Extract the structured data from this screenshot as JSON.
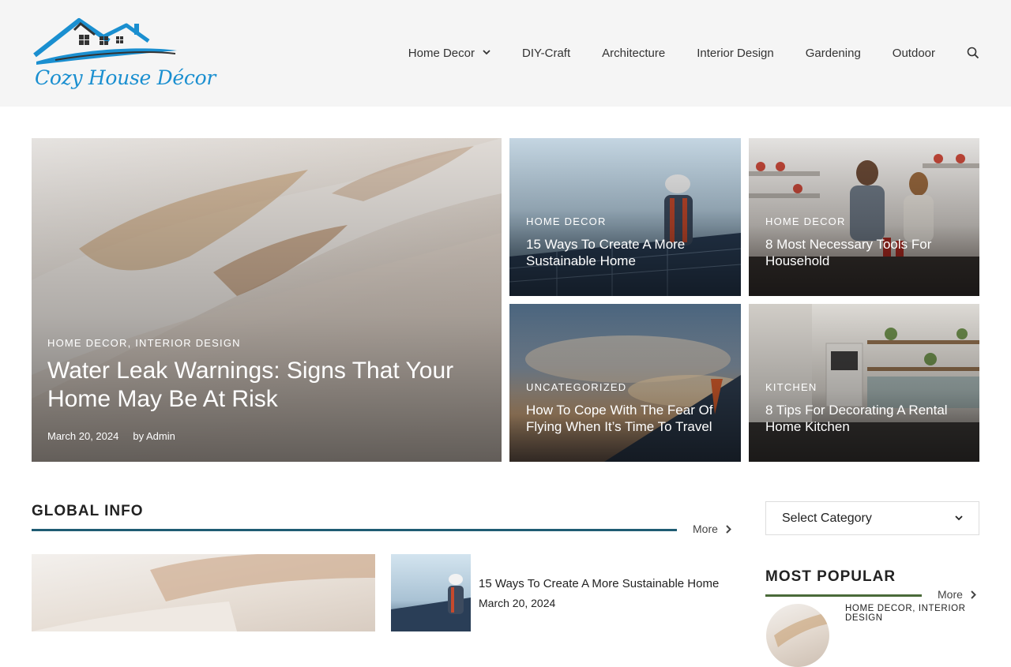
{
  "brand": {
    "name": "Cozy House Décor"
  },
  "nav": {
    "items": [
      {
        "label": "Home Decor",
        "has_dropdown": true
      },
      {
        "label": "DIY-Craft"
      },
      {
        "label": "Architecture"
      },
      {
        "label": "Interior Design"
      },
      {
        "label": "Gardening"
      },
      {
        "label": "Outdoor"
      }
    ],
    "search_icon": "search-icon"
  },
  "hero": {
    "featured": {
      "categories": [
        "HOME DECOR",
        "INTERIOR DESIGN"
      ],
      "category_separator": ",",
      "title": "Water Leak Warnings: Signs That Your Home May Be At Risk",
      "date": "March 20, 2024",
      "author_prefix": "by",
      "author": "Admin"
    },
    "tiles": [
      {
        "category": "HOME DECOR",
        "title": "15 Ways To Create A More Sustainable Home"
      },
      {
        "category": "HOME DECOR",
        "title": "8 Most Necessary Tools For Household"
      },
      {
        "category": "UNCATEGORIZED",
        "title": "How To Cope With The Fear Of Flying When It’s Time To Travel"
      },
      {
        "category": "KITCHEN",
        "title": "8 Tips For Decorating A Rental Home Kitchen"
      }
    ]
  },
  "global_info": {
    "heading": "GLOBAL INFO",
    "more_label": "More",
    "list": [
      {
        "title": "15 Ways To Create A More Sustainable Home",
        "date": "March 20, 2024"
      }
    ]
  },
  "sidebar": {
    "category_select": {
      "selected": "Select Category"
    },
    "most_popular": {
      "heading": "MOST POPULAR",
      "more_label": "More",
      "first_item_categories": "HOME DECOR, INTERIOR DESIGN"
    }
  },
  "colors": {
    "header_bg": "#f5f5f5",
    "logo_blue": "#1a8fd0",
    "global_rule": "#1f5c73",
    "popular_rule": "#4a6a3a"
  }
}
